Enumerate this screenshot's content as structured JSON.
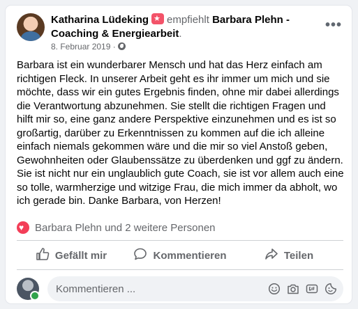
{
  "post": {
    "author": "Katharina Lüdeking",
    "recommends": "empfiehlt",
    "page": "Barbara Plehn - Coaching & Energiearbeit",
    "period": ".",
    "date": "8. Februar 2019",
    "separator": "·",
    "more_label": "•••",
    "text": "Barbara ist ein wunderbarer Mensch und hat das Herz einfach am richtigen Fleck. In unserer Arbeit geht es ihr immer um mich und sie möchte, dass wir ein gutes Ergebnis finden, ohne mir dabei allerdings die Verantwortung abzunehmen. Sie stellt die richtigen Fragen und hilft mir so, eine ganz andere Perspektive einzunehmen und es ist so großartig, darüber zu Erkenntnissen zu kommen auf die ich alleine einfach niemals gekommen wäre und die mir so viel Anstoß geben, Gewohnheiten oder Glaubenssätze zu überdenken und ggf zu ändern. Sie ist nicht nur ein unglaublich gute Coach, sie ist vor allem auch eine so tolle, warmherzige und witzige Frau, die mich immer da abholt, wo ich gerade bin. Danke Barbara, von Herzen!",
    "reactions": "Barbara Plehn und 2 weitere Personen"
  },
  "actions": {
    "like": "Gefällt mir",
    "comment": "Kommentieren",
    "share": "Teilen"
  },
  "comment_input": {
    "placeholder": "Kommentieren ..."
  },
  "icons": {
    "recommend_badge": "star-badge-icon",
    "privacy": "globe-icon",
    "reaction": "heart-icon",
    "like": "thumbs-up-icon",
    "comment": "speech-bubble-icon",
    "share": "share-arrow-icon",
    "emoji": "emoji-icon",
    "photo": "camera-icon",
    "gif": "gif-icon",
    "sticker": "sticker-icon"
  },
  "colors": {
    "heart": "#f33e58",
    "badge": "#f35369",
    "muted": "#65676b",
    "text": "#050505"
  }
}
